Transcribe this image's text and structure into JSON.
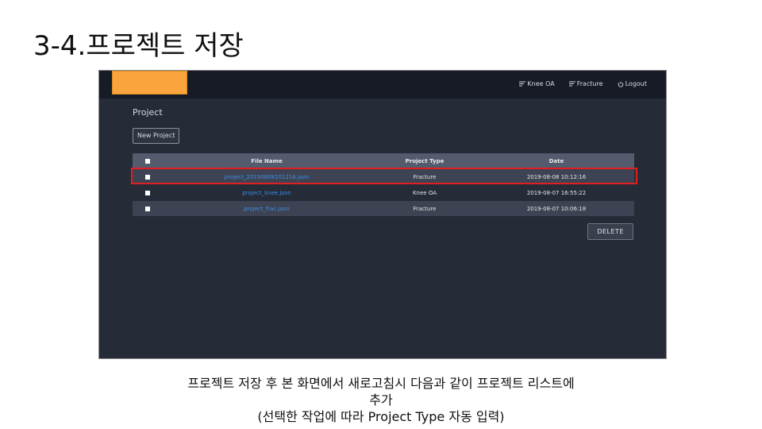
{
  "slide": {
    "title": "3-4.프로젝트 저장"
  },
  "app": {
    "brand_color": "#f9a43d",
    "navbar": {
      "links": [
        {
          "icon": "menu-lines-icon",
          "label": "Knee OA"
        },
        {
          "icon": "menu-lines-icon",
          "label": "Fracture"
        },
        {
          "icon": "power-icon",
          "label": "Logout"
        }
      ]
    },
    "main": {
      "heading": "Project",
      "new_project_label": "New Project",
      "delete_label": "DELETE",
      "table": {
        "columns": [
          "File Name",
          "Project Type",
          "Date"
        ],
        "rows": [
          {
            "file": "project_20190808101216.json",
            "type": "Fracture",
            "date": "2019-08-08 10:12:16"
          },
          {
            "file": "project_knee.json",
            "type": "Knee OA",
            "date": "2019-08-07 16:55:22"
          },
          {
            "file": "project_frac.json",
            "type": "Fracture",
            "date": "2019-08-07 10:06:18"
          }
        ]
      },
      "highlight_color": "#e02020"
    }
  },
  "caption": {
    "line1": "프로젝트 저장 후 본 화면에서 새로고침시 다음과 같이 프로젝트 리스트에",
    "line2": "추가",
    "line3": "(선택한 작업에 따라 Project Type 자동 입력)"
  }
}
